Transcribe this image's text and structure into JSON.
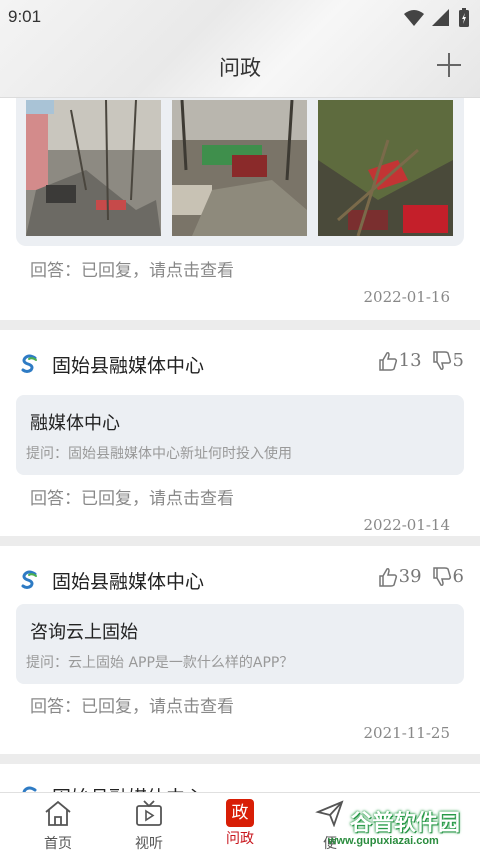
{
  "status_bar": {
    "time": "9:01"
  },
  "header": {
    "title": "问政"
  },
  "posts_top": {
    "answer": "回答：已回复，请点击查看",
    "date": "2022-01-16"
  },
  "posts": [
    {
      "author": "固始县融媒体中心",
      "likes": "13",
      "dislikes": "5",
      "title": "融媒体中心",
      "question": "提问：固始县融媒体中心新址何时投入使用",
      "answer": "回答：已回复，请点击查看",
      "date": "2022-01-14"
    },
    {
      "author": "固始县融媒体中心",
      "likes": "39",
      "dislikes": "6",
      "title": "咨询云上固始",
      "question": "提问：云上固始  APP是一款什么样的APP？",
      "answer": "回答：已回复，请点击查看",
      "date": "2021-11-25"
    },
    {
      "author": "固始县融媒体中心"
    }
  ],
  "nav": {
    "items": [
      {
        "label": "首页",
        "icon": "home-icon"
      },
      {
        "label": "视听",
        "icon": "tv-icon"
      },
      {
        "label": "问政",
        "icon": "zheng-icon",
        "badge": "政",
        "active": true
      },
      {
        "label": "便",
        "icon": "send-icon"
      }
    ]
  },
  "watermark": {
    "text": "谷普软件园",
    "url": "www.gupuxiazai.com"
  },
  "colors": {
    "accent": "#c8161d",
    "box": "#eceff3",
    "divider": "#ececec"
  }
}
